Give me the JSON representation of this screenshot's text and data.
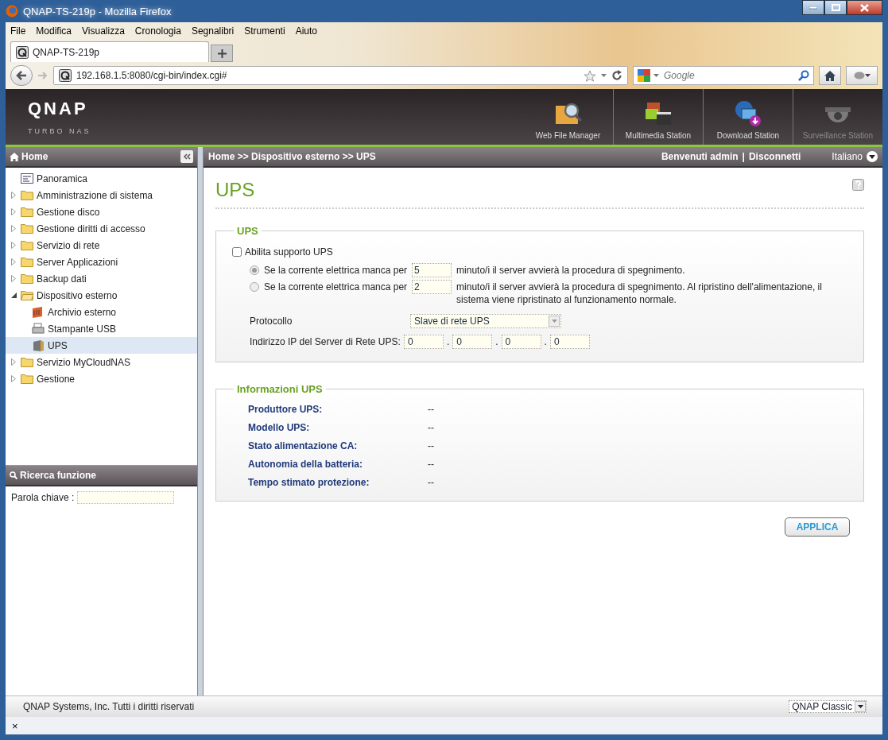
{
  "window": {
    "title": "QNAP-TS-219p - Mozilla Firefox"
  },
  "menu": [
    {
      "label": "File"
    },
    {
      "label": "Modifica"
    },
    {
      "label": "Visualizza"
    },
    {
      "label": "Cronologia"
    },
    {
      "label": "Segnalibri"
    },
    {
      "label": "Strumenti"
    },
    {
      "label": "Aiuto"
    }
  ],
  "tabs": [
    {
      "label": "QNAP-TS-219p",
      "selected": true
    }
  ],
  "nav": {
    "url": "192.168.1.5:8080/cgi-bin/index.cgi#",
    "search": {
      "placeholder": "Google"
    }
  },
  "brand": {
    "logo": "QNAP",
    "subtitle": "TURBO NAS"
  },
  "apps": [
    {
      "label": "Web File Manager",
      "kind": "files",
      "disabled": false
    },
    {
      "label": "Multimedia Station",
      "kind": "media",
      "disabled": false
    },
    {
      "label": "Download Station",
      "kind": "download",
      "disabled": false
    },
    {
      "label": "Surveillance Station",
      "kind": "camera",
      "disabled": true
    }
  ],
  "sidebar": {
    "title": "Home",
    "tree": [
      {
        "label": "Panoramica",
        "kind": "page",
        "selected": false
      },
      {
        "label": "Amministrazione di sistema",
        "kind": "folder",
        "expanded": false,
        "selected": false
      },
      {
        "label": "Gestione disco",
        "kind": "folder",
        "expanded": false,
        "selected": false
      },
      {
        "label": "Gestione diritti di accesso",
        "kind": "folder",
        "expanded": false,
        "selected": false
      },
      {
        "label": "Servizio di rete",
        "kind": "folder",
        "expanded": false,
        "selected": false
      },
      {
        "label": "Server Applicazioni",
        "kind": "folder",
        "expanded": false,
        "selected": false
      },
      {
        "label": "Backup dati",
        "kind": "folder",
        "expanded": false,
        "selected": false
      },
      {
        "label": "Dispositivo esterno",
        "kind": "folder",
        "expanded": true,
        "selected": false,
        "children": [
          {
            "label": "Archivio esterno",
            "kind": "storage",
            "selected": false
          },
          {
            "label": "Stampante USB",
            "kind": "printer",
            "selected": false
          },
          {
            "label": "UPS",
            "kind": "ups",
            "selected": true
          }
        ]
      },
      {
        "label": "Servizio MyCloudNAS",
        "kind": "folder",
        "expanded": false,
        "selected": false
      },
      {
        "label": "Gestione",
        "kind": "folder",
        "expanded": false,
        "selected": false
      }
    ],
    "search": {
      "title": "Ricerca funzione",
      "label": "Parola chiave :"
    }
  },
  "header": {
    "breadcrumb": "Home >> Dispositivo esterno >> UPS",
    "welcome": "Benvenuti admin",
    "separator": "|",
    "logout": "Disconnetti",
    "language": "Italiano"
  },
  "page": {
    "title": "UPS"
  },
  "ups_settings": {
    "legend": "UPS",
    "enable": {
      "label": "Abilita supporto UPS",
      "checked": false
    },
    "options": [
      {
        "selected": true,
        "before": "Se la corrente elettrica manca per",
        "value": "5",
        "after": "minuto/i il server avvierà la procedura di spegnimento."
      },
      {
        "selected": false,
        "before": "Se la corrente elettrica manca per",
        "value": "2",
        "after": "minuto/i il server avvierà la procedura di spegnimento. Al ripristino dell'alimentazione, il sistema viene ripristinato al funzionamento normale."
      }
    ],
    "protocol": {
      "label": "Protocollo",
      "value": "Slave di rete UPS"
    },
    "ip": {
      "label": "Indirizzo IP del Server di Rete UPS:",
      "octets": [
        "0",
        "0",
        "0",
        "0"
      ],
      "separators": [
        ".",
        ".",
        "."
      ]
    }
  },
  "ups_info": {
    "legend": "Informazioni UPS",
    "rows": [
      {
        "label": "Produttore UPS:",
        "value": "--"
      },
      {
        "label": "Modello UPS:",
        "value": "--"
      },
      {
        "label": "Stato alimentazione CA:",
        "value": "--"
      },
      {
        "label": "Autonomia della batteria:",
        "value": "--"
      },
      {
        "label": "Tempo stimato protezione:",
        "value": "--"
      }
    ]
  },
  "apply_button": {
    "label": "APPLICA"
  },
  "footer": {
    "copyright": "QNAP Systems, Inc. Tutti i diritti riservati",
    "theme": "QNAP Classic"
  },
  "status_bar": {
    "close": "×"
  }
}
